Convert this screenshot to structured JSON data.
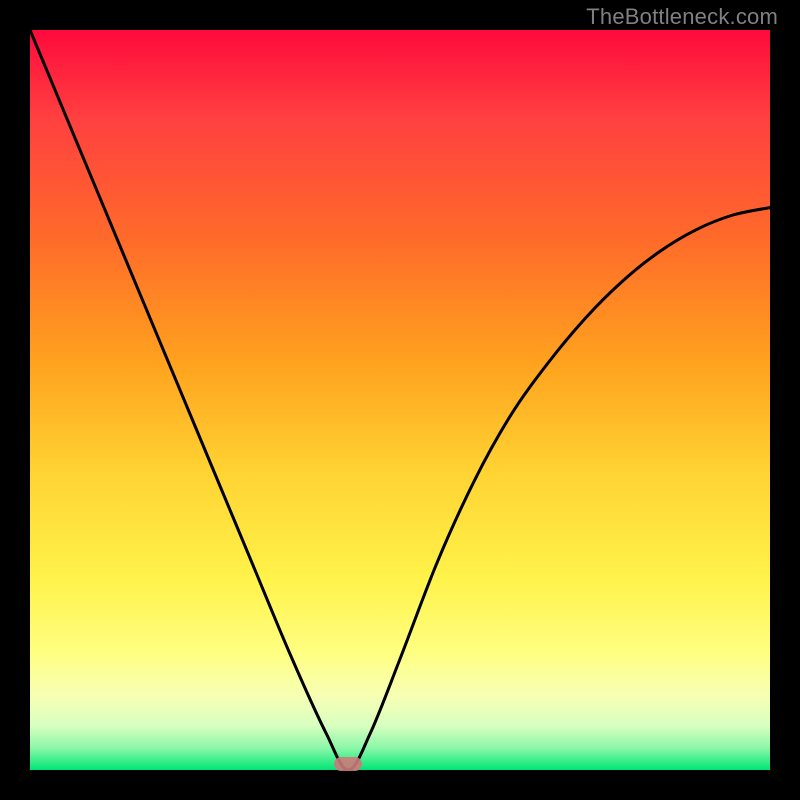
{
  "watermark": {
    "text": "TheBottleneck.com"
  },
  "colors": {
    "frame": "#000000",
    "curve": "#000000",
    "marker": "#cc7a7a",
    "gradient_stops": [
      "#ff0a3c",
      "#ff4040",
      "#ff6a2a",
      "#ffa21e",
      "#ffd433",
      "#fff24a",
      "#ffff80",
      "#f7ffb4",
      "#d8ffc0",
      "#8cf7a8",
      "#00e676"
    ]
  },
  "chart_data": {
    "type": "line",
    "title": "",
    "xlabel": "",
    "ylabel": "",
    "xlim": [
      0,
      1
    ],
    "ylim": [
      0,
      1
    ],
    "marker": {
      "x": 0.43,
      "y": 0.0
    },
    "series": [
      {
        "name": "curve",
        "x": [
          0.0,
          0.05,
          0.1,
          0.15,
          0.2,
          0.25,
          0.3,
          0.35,
          0.4,
          0.43,
          0.46,
          0.5,
          0.55,
          0.6,
          0.65,
          0.7,
          0.75,
          0.8,
          0.85,
          0.9,
          0.95,
          1.0
        ],
        "values": [
          1.0,
          0.88,
          0.76,
          0.64,
          0.52,
          0.4,
          0.28,
          0.16,
          0.05,
          0.0,
          0.05,
          0.15,
          0.28,
          0.39,
          0.48,
          0.55,
          0.61,
          0.66,
          0.7,
          0.73,
          0.75,
          0.76
        ]
      }
    ]
  }
}
